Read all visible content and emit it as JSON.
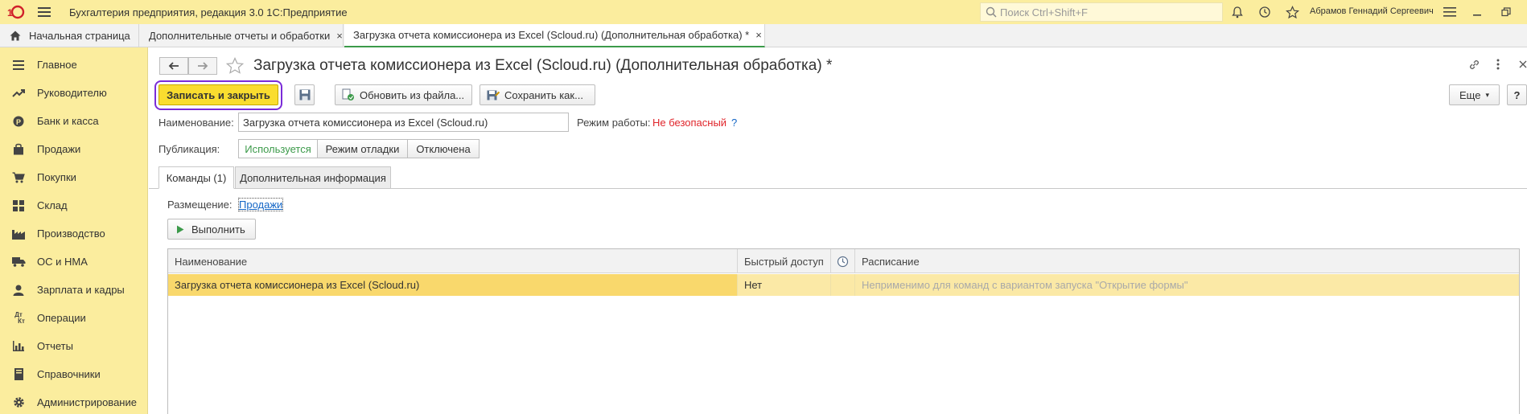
{
  "titlebar": {
    "logo_text": "1С",
    "app_title": "Бухгалтерия предприятия, редакция 3.0 1С:Предприятие",
    "search_placeholder": "Поиск Ctrl+Shift+F",
    "user_name": "Абрамов Геннадий Сергеевич"
  },
  "tabs": [
    {
      "label": "Начальная страница"
    },
    {
      "label": "Дополнительные отчеты и обработки",
      "close": "×"
    },
    {
      "label": "Загрузка отчета комиссионера из Excel (Scloud.ru) (Дополнительная обработка) *",
      "close": "×"
    }
  ],
  "sidebar": {
    "items": [
      {
        "label": "Главное",
        "icon": "menu-lines-icon"
      },
      {
        "label": "Руководителю",
        "icon": "trend-icon"
      },
      {
        "label": "Банк и касса",
        "icon": "coin-icon"
      },
      {
        "label": "Продажи",
        "icon": "bag-icon"
      },
      {
        "label": "Покупки",
        "icon": "cart-icon"
      },
      {
        "label": "Склад",
        "icon": "grid-icon"
      },
      {
        "label": "Производство",
        "icon": "factory-icon"
      },
      {
        "label": "ОС и НМА",
        "icon": "truck-icon"
      },
      {
        "label": "Зарплата и кадры",
        "icon": "person-icon"
      },
      {
        "label": "Операции",
        "icon": "dt-kt-icon",
        "icon_text_top": "Дт",
        "icon_text_bottom": "Кт"
      },
      {
        "label": "Отчеты",
        "icon": "bar-chart-icon"
      },
      {
        "label": "Справочники",
        "icon": "book-icon"
      },
      {
        "label": "Администрирование",
        "icon": "gear-icon"
      }
    ]
  },
  "form": {
    "title": "Загрузка отчета комиссионера из Excel (Scloud.ru) (Дополнительная обработка) *",
    "toolbar": {
      "save_close": "Записать и закрыть",
      "update_from_file": "Обновить из файла...",
      "save_as": "Сохранить как...",
      "more": "Еще",
      "more_arrow": "▾",
      "help": "?"
    },
    "name_label": "Наименование:",
    "name_value": "Загрузка отчета комиссионера из Excel (Scloud.ru)",
    "mode_label": "Режим работы:",
    "mode_value": "Не безопасный",
    "mode_help": "?",
    "publication_label": "Публикация:",
    "publication_options": [
      "Используется",
      "Режим отладки",
      "Отключена"
    ],
    "page_tabs": [
      "Команды (1)",
      "Дополнительная информация"
    ],
    "placement_label": "Размещение:",
    "placement_value": "Продажи",
    "run_button": "Выполнить",
    "table": {
      "columns": [
        "Наименование",
        "Быстрый доступ",
        "",
        "Расписание"
      ],
      "rows": [
        {
          "name": "Загрузка отчета комиссионера из Excel (Scloud.ru)",
          "quick_access": "Нет",
          "icon_col": "",
          "schedule": "Неприменимо для команд с вариантом запуска \"Открытие формы\""
        }
      ]
    }
  }
}
